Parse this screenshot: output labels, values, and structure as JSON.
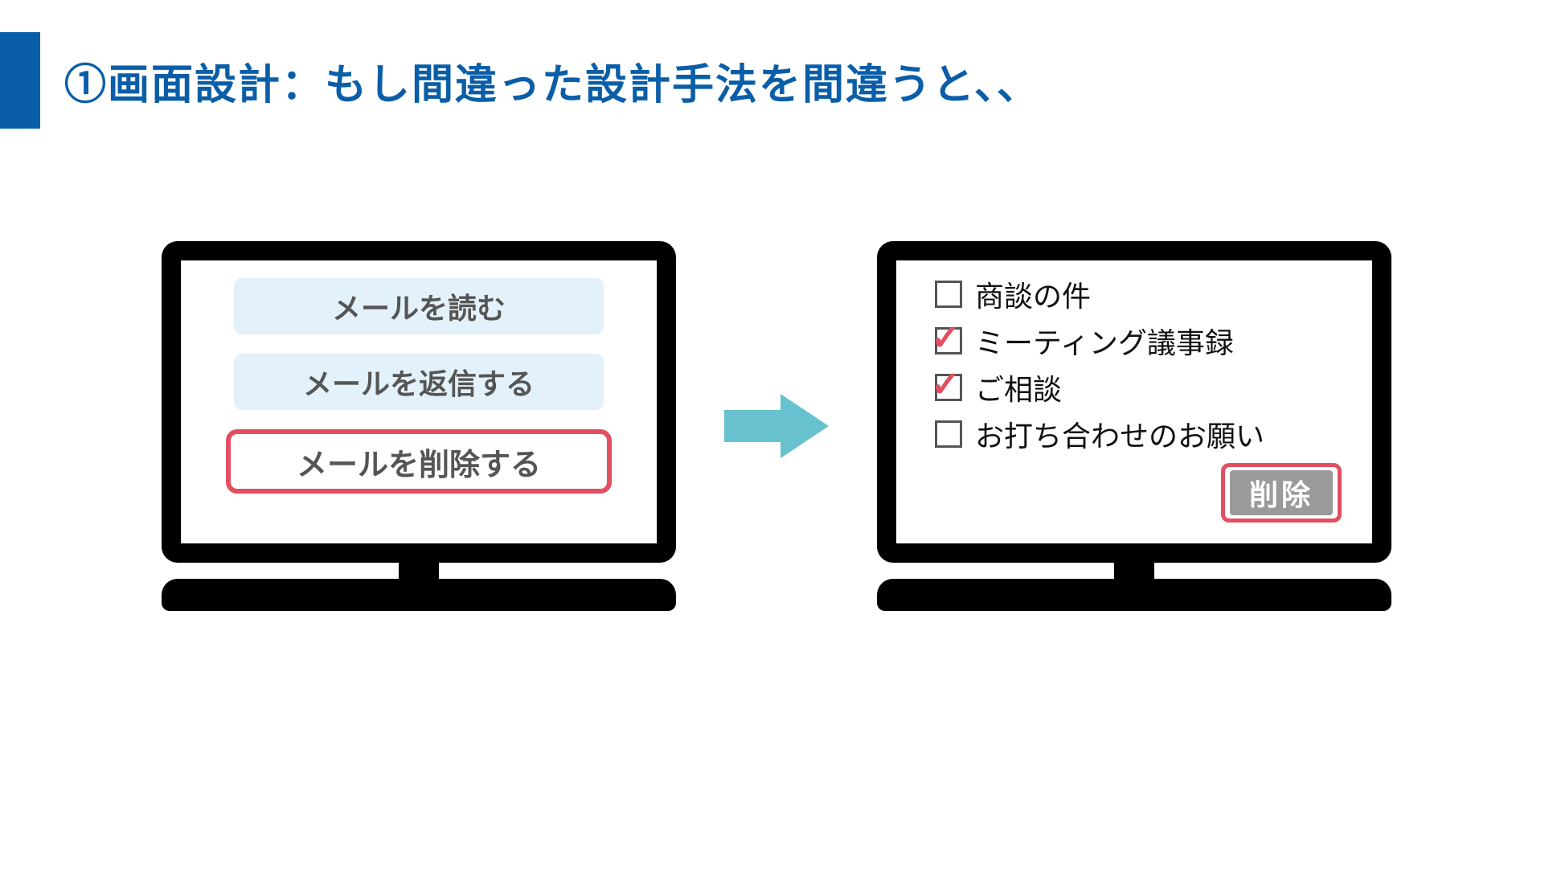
{
  "title": "①画面設計：もし間違った設計手法を間違うと、、",
  "screen1": {
    "btn_read": "メールを読む",
    "btn_reply": "メールを返信する",
    "btn_delete": "メールを削除する"
  },
  "screen2": {
    "items": [
      {
        "label": "商談の件",
        "checked": false
      },
      {
        "label": "ミーティング議事録",
        "checked": true
      },
      {
        "label": "ご相談",
        "checked": true
      },
      {
        "label": "お打ち合わせのお願い",
        "checked": false
      }
    ],
    "delete_label": "削除"
  }
}
